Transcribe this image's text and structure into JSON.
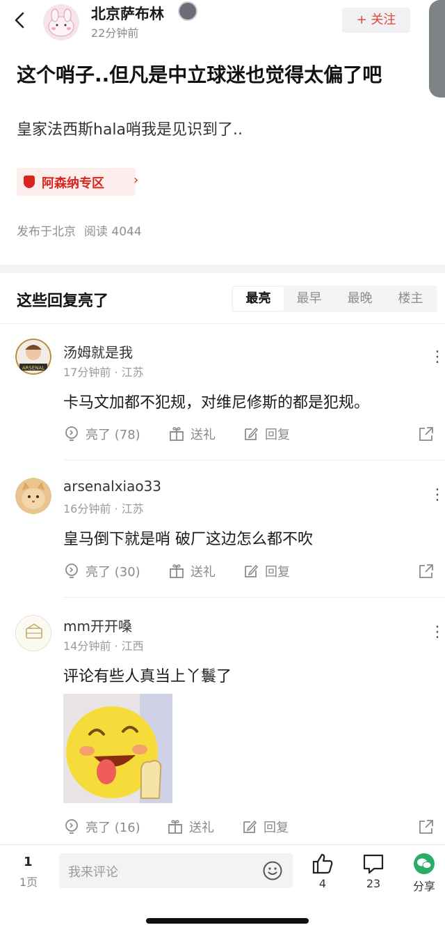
{
  "header": {
    "author_name": "北京萨布林",
    "time_ago": "22分钟前",
    "follow_label": "+ 关注",
    "side_tab_glyph": "《"
  },
  "post": {
    "title": "这个哨子..但凡是中立球迷也觉得太偏了吧",
    "body": "皇家法西斯hala哨我是见识到了..",
    "topic_tag": "阿森纳专区",
    "location": "发布于北京",
    "reads": "阅读 4044"
  },
  "replies_section": {
    "title": "这些回复亮了",
    "sort_tabs": [
      "最亮",
      "最早",
      "最晚",
      "楼主"
    ],
    "active_sort": "最亮"
  },
  "replies": [
    {
      "username": "汤姆就是我",
      "meta": "17分钟前 · 江苏",
      "text": "卡马文加都不犯规，对维尼修斯的都是犯规。",
      "likes": "亮了 (78)",
      "gift": "送礼",
      "reply": "回复",
      "avatar_caption": "ARSENAL"
    },
    {
      "username": "arsenalxiao33",
      "meta": "16分钟前 · 江苏",
      "text": "皇马倒下就是哨 破厂这边怎么都不吹",
      "likes": "亮了 (30)",
      "gift": "送礼",
      "reply": "回复"
    },
    {
      "username": "mm开开嗓",
      "meta": "14分钟前 · 江西",
      "text": "评论有些人真当上丫鬟了",
      "likes": "亮了 (16)",
      "gift": "送礼",
      "reply": "回复"
    }
  ],
  "bottom_bar": {
    "page_number": "1",
    "page_label": "1页",
    "comment_placeholder": "我来评论",
    "like_count": "4",
    "comment_count": "23",
    "share_label": "分享"
  },
  "colors": {
    "accent_red": "#e5433e",
    "arsenal_red": "#d9251d",
    "wechat_green": "#2aae67"
  }
}
